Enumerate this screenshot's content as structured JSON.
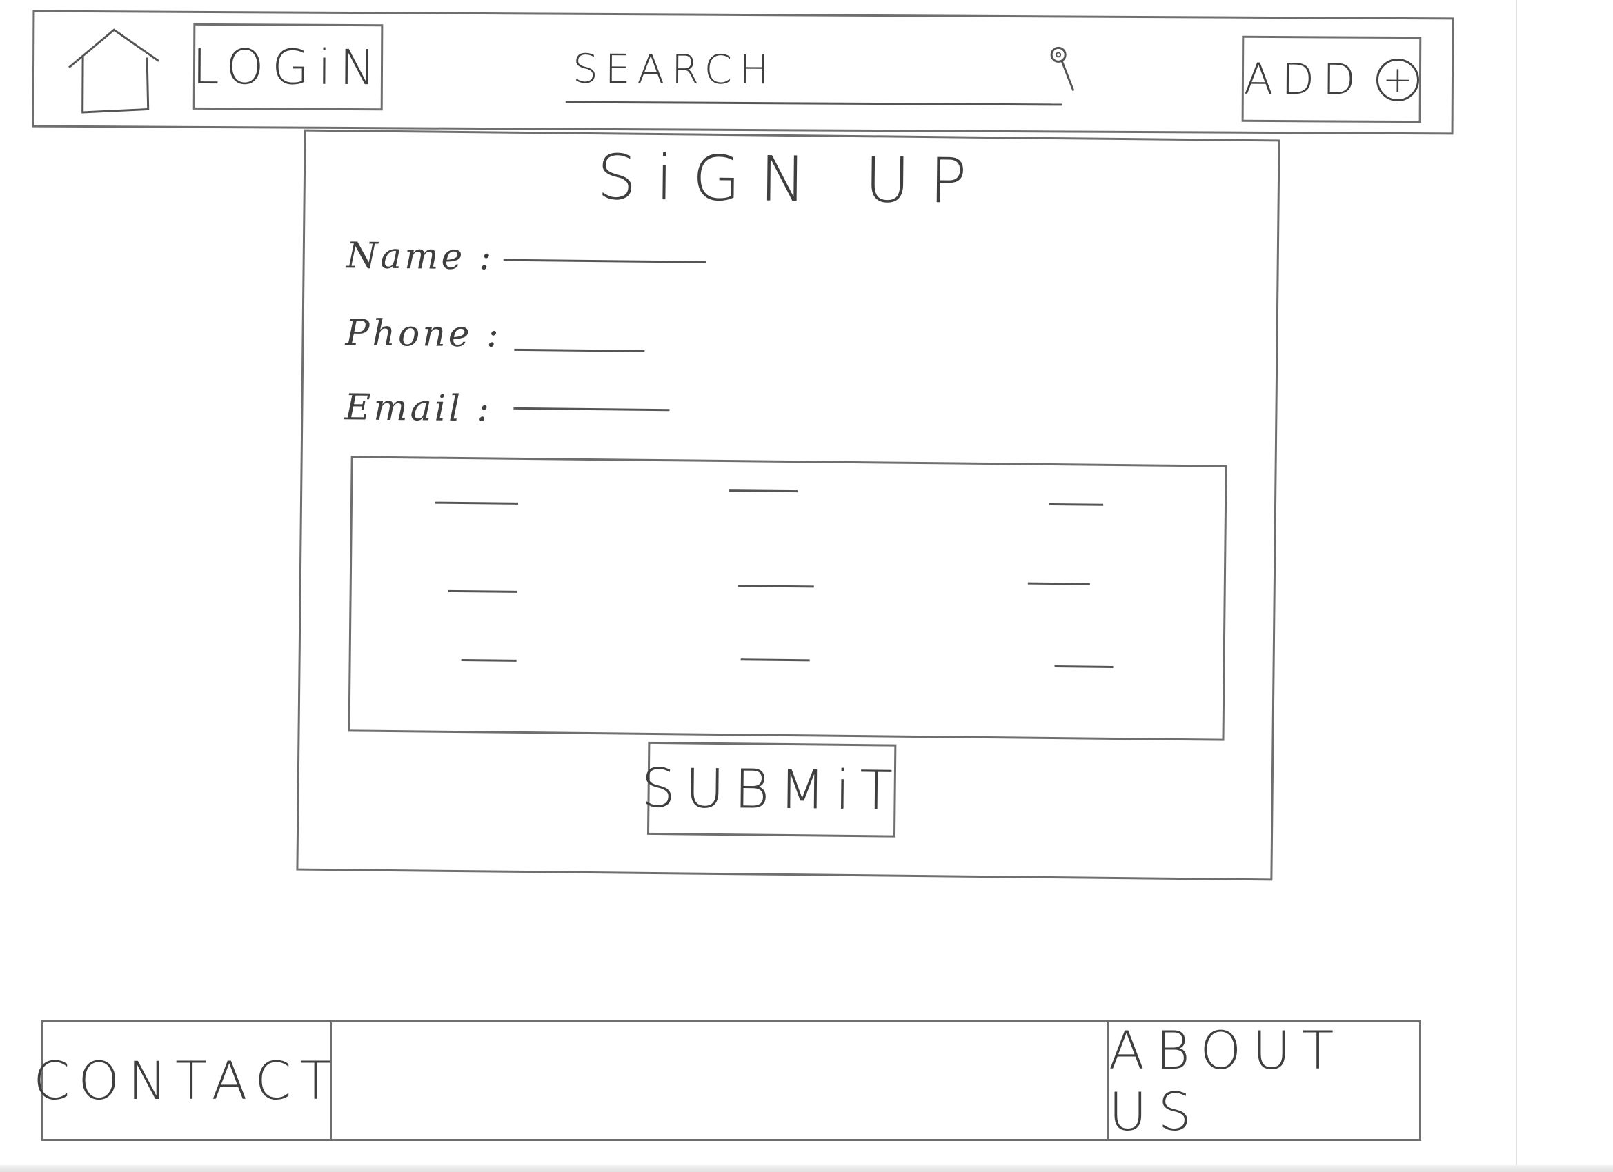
{
  "header": {
    "home_icon": "home-icon",
    "login_label": "LOGiN",
    "search_placeholder": "SEARCH",
    "search_icon": "search-icon",
    "add_label": "ADD",
    "add_icon": "plus-circle-icon"
  },
  "signup": {
    "title": "SiGN UP",
    "fields": [
      {
        "label": "Name :",
        "value": ""
      },
      {
        "label": "Phone :",
        "value": ""
      },
      {
        "label": "Email :",
        "value": ""
      }
    ],
    "submit_label": "SUBMiT"
  },
  "footer": {
    "contact_label": "CONTACT",
    "about_label": "ABOUT US"
  }
}
